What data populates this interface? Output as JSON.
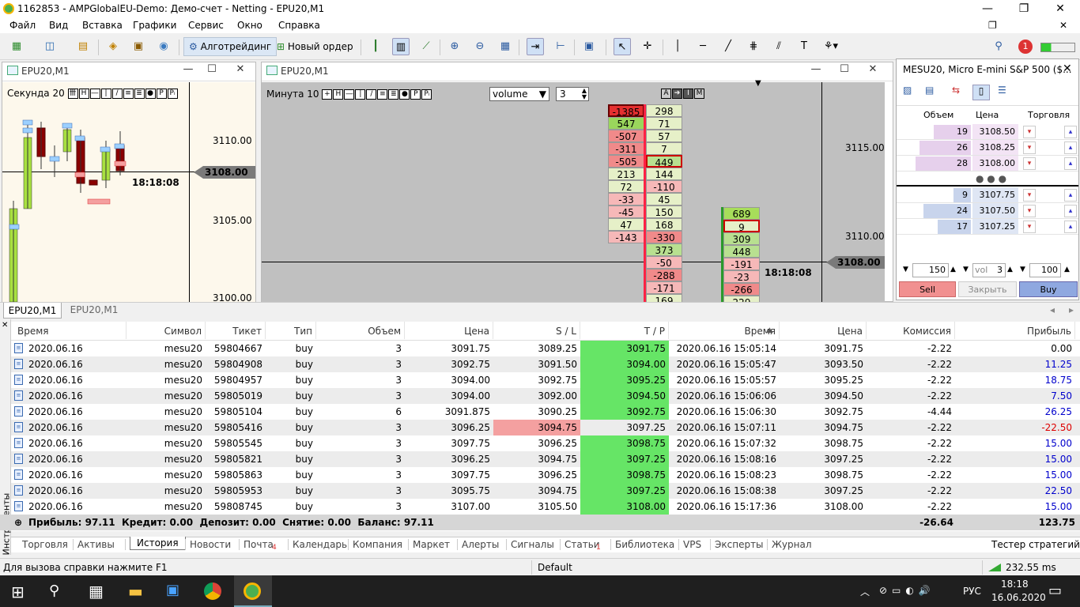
{
  "window": {
    "title": "1162853 - AMPGlobalEU-Demo: Демо-счет - Netting - EPU20,M1"
  },
  "menu": [
    "Файл",
    "Вид",
    "Вставка",
    "Графики",
    "Сервис",
    "Окно",
    "Справка"
  ],
  "toolbar": {
    "algo_label": "Алготрейдинг",
    "order_label": "Новый ордер",
    "notif_count": "1"
  },
  "chart1": {
    "title": "EPU20,M1",
    "period": "Секунда",
    "period_val": "20",
    "prices": [
      "3110.00",
      "3105.00",
      "3100.00"
    ],
    "current": "3108.00",
    "time": "18:18:08"
  },
  "chart2": {
    "title": "EPU20,M1",
    "period": "Минута",
    "period_val": "10",
    "select": "volume",
    "spin": "3",
    "btn_a": "A",
    "btn_m": "M",
    "prices": [
      "3115.00",
      "3110.00"
    ],
    "current": "3108.00",
    "time": "18:18:08",
    "col1": [
      "-1385",
      "547",
      "-507",
      "-311",
      "-505",
      "213",
      "72",
      "-33",
      "-45",
      "47",
      "-143"
    ],
    "col2": [
      "298",
      "71",
      "57",
      "7",
      "449",
      "144",
      "-110",
      "45",
      "150",
      "168",
      "-330",
      "373",
      "-50",
      "-288",
      "-171",
      "169"
    ],
    "col3": [
      "689",
      "9",
      "309",
      "448",
      "-191",
      "-23",
      "-266",
      "229"
    ]
  },
  "dom": {
    "title": "MESU20, Micro E-mini S&P 500 ($...",
    "headers": [
      "Объем",
      "Цена",
      "Торговля"
    ],
    "asks": [
      {
        "vol": "19",
        "price": "3108.50"
      },
      {
        "vol": "26",
        "price": "3108.25"
      },
      {
        "vol": "28",
        "price": "3108.00"
      }
    ],
    "bids": [
      {
        "vol": "9",
        "price": "3107.75"
      },
      {
        "vol": "24",
        "price": "3107.50"
      },
      {
        "vol": "17",
        "price": "3107.25"
      }
    ],
    "qty1": "150",
    "vol_label": "vol",
    "vol_val": "3",
    "qty2": "100",
    "sell": "Sell",
    "close": "Закрыть",
    "buy": "Buy"
  },
  "chart_tabs": [
    "EPU20,M1",
    "EPU20,M1"
  ],
  "history": {
    "headers": [
      "Время",
      "Символ",
      "Тикет",
      "Тип",
      "Объем",
      "Цена",
      "S / L",
      "T / P",
      "Время",
      "Цена",
      "Комиссия",
      "Прибыль"
    ],
    "rows": [
      [
        "2020.06.16 15:05:14",
        "mesu20",
        "59804667",
        "buy",
        "3",
        "3091.75",
        "3089.25",
        "3091.75",
        "2020.06.16 15:05:14",
        "3091.75",
        "-2.22",
        "0.00"
      ],
      [
        "2020.06.16 15:05:46",
        "mesu20",
        "59804908",
        "buy",
        "3",
        "3092.75",
        "3091.50",
        "3094.00",
        "2020.06.16 15:05:47",
        "3093.50",
        "-2.22",
        "11.25"
      ],
      [
        "2020.06.16 15:05:55",
        "mesu20",
        "59804957",
        "buy",
        "3",
        "3094.00",
        "3092.75",
        "3095.25",
        "2020.06.16 15:05:57",
        "3095.25",
        "-2.22",
        "18.75"
      ],
      [
        "2020.06.16 15:06:05",
        "mesu20",
        "59805019",
        "buy",
        "3",
        "3094.00",
        "3092.00",
        "3094.50",
        "2020.06.16 15:06:06",
        "3094.50",
        "-2.22",
        "7.50"
      ],
      [
        "2020.06.16 15:06:14",
        "mesu20",
        "59805104",
        "buy",
        "6",
        "3091.875",
        "3090.25",
        "3092.75",
        "2020.06.16 15:06:30",
        "3092.75",
        "-4.44",
        "26.25"
      ],
      [
        "2020.06.16 15:07:04",
        "mesu20",
        "59805416",
        "buy",
        "3",
        "3096.25",
        "3094.75",
        "3097.25",
        "2020.06.16 15:07:11",
        "3094.75",
        "-2.22",
        "-22.50"
      ],
      [
        "2020.06.16 15:07:29",
        "mesu20",
        "59805545",
        "buy",
        "3",
        "3097.75",
        "3096.25",
        "3098.75",
        "2020.06.16 15:07:32",
        "3098.75",
        "-2.22",
        "15.00"
      ],
      [
        "2020.06.16 15:08:12",
        "mesu20",
        "59805821",
        "buy",
        "3",
        "3096.25",
        "3094.75",
        "3097.25",
        "2020.06.16 15:08:16",
        "3097.25",
        "-2.22",
        "15.00"
      ],
      [
        "2020.06.16 15:08:19",
        "mesu20",
        "59805863",
        "buy",
        "3",
        "3097.75",
        "3096.25",
        "3098.75",
        "2020.06.16 15:08:23",
        "3098.75",
        "-2.22",
        "15.00"
      ],
      [
        "2020.06.16 15:08:36",
        "mesu20",
        "59805953",
        "buy",
        "3",
        "3095.75",
        "3094.75",
        "3097.25",
        "2020.06.16 15:08:38",
        "3097.25",
        "-2.22",
        "22.50"
      ],
      [
        "2020.06.16 15:17:26",
        "mesu20",
        "59808745",
        "buy",
        "3",
        "3107.00",
        "3105.50",
        "3108.00",
        "2020.06.16 15:17:36",
        "3108.00",
        "-2.22",
        "15.00"
      ]
    ],
    "summary": "Прибыль: 97.11  Кредит: 0.00  Депозит: 0.00  Снятие: 0.00  Баланс: 97.11",
    "sum_comm": "-26.64",
    "sum_profit": "123.75"
  },
  "side_label": "Инструменты",
  "bottom_tabs": [
    "Торговля",
    "Активы",
    "История",
    "Новости",
    "Почта",
    "Календарь",
    "Компания",
    "Маркет",
    "Алерты",
    "Сигналы",
    "Статьи",
    "Библиотека",
    "VPS",
    "Эксперты",
    "Журнал"
  ],
  "mail_badge": "4",
  "articles_badge": "1",
  "tester": "Тестер стратегий",
  "status": {
    "help": "Для вызова справки нажмите F1",
    "profile": "Default",
    "ping": "232.55 ms"
  },
  "taskbar": {
    "lang": "РУС",
    "time": "18:18",
    "date": "16.06.2020"
  },
  "colors": {
    "green": "#66e566",
    "red": "#f4a0a0",
    "profit_pos": "#0000cc",
    "profit_neg": "#dd0000"
  }
}
